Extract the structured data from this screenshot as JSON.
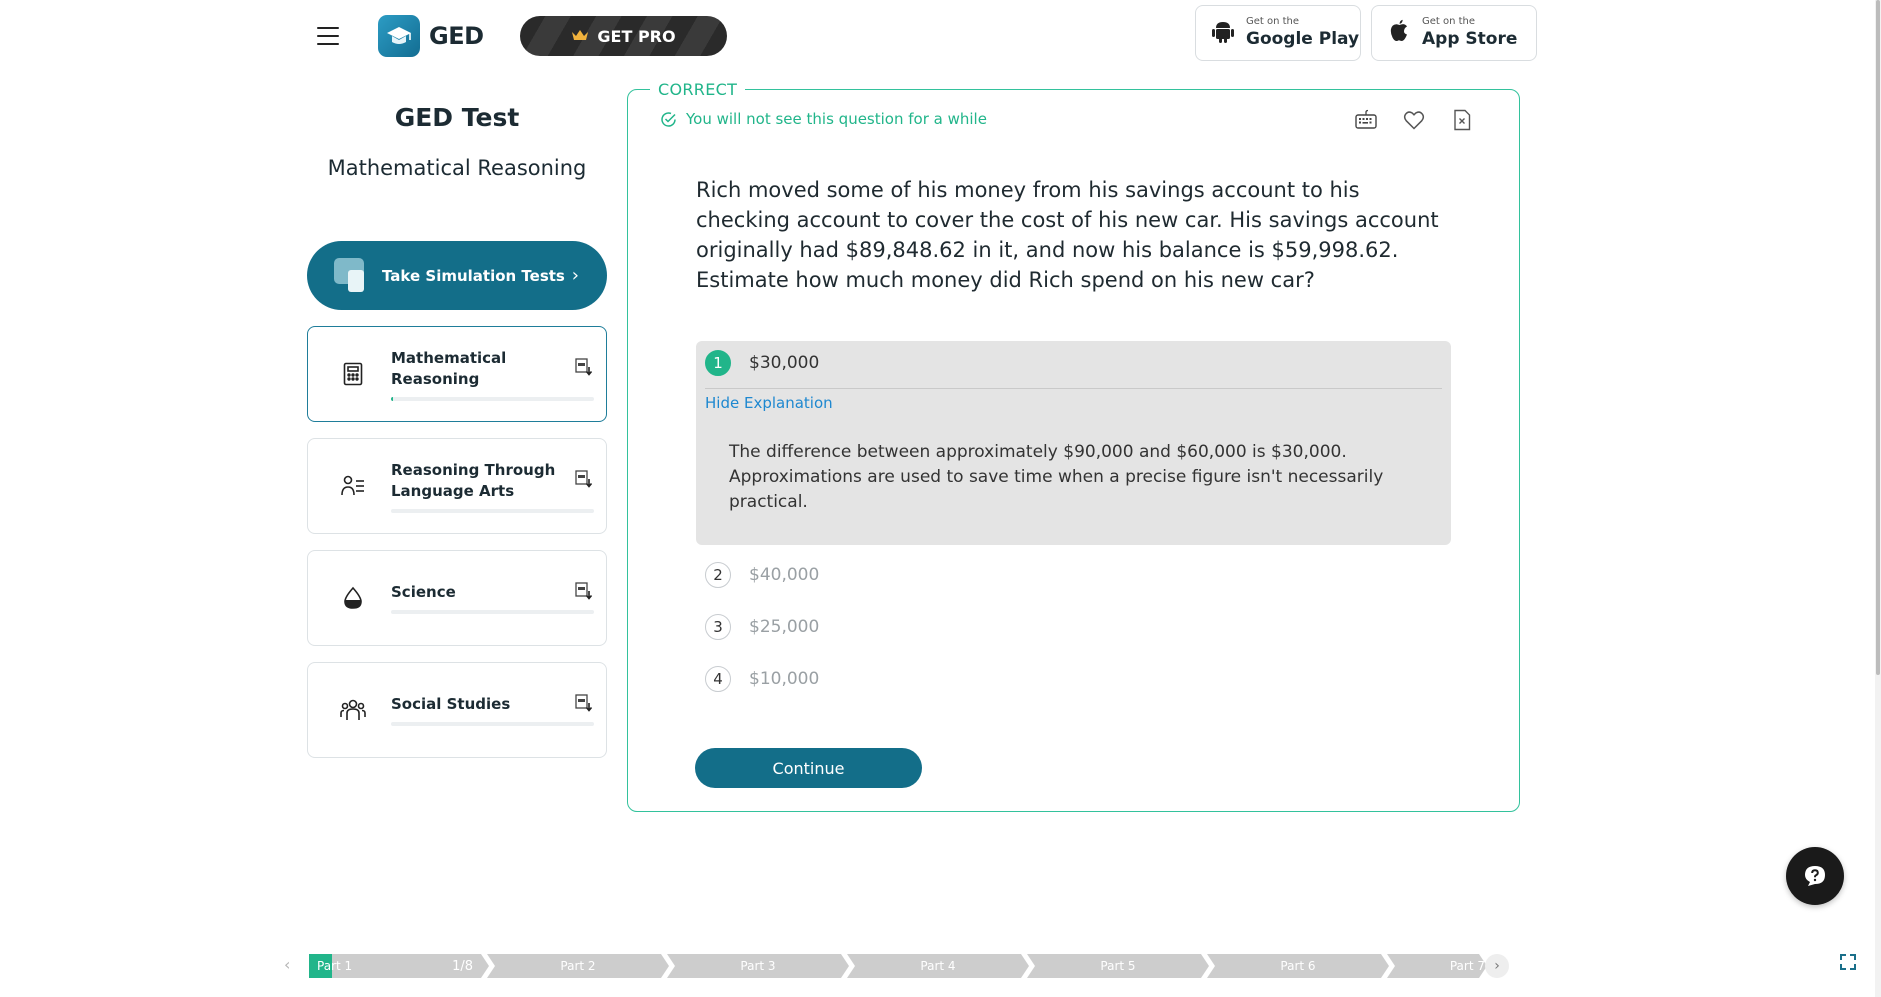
{
  "header": {
    "logo_text": "GED",
    "get_pro_label": "GET PRO",
    "google_play": {
      "small": "Get on the",
      "big": "Google Play"
    },
    "app_store": {
      "small": "Get on the",
      "big": "App Store"
    }
  },
  "sidebar": {
    "title": "GED Test",
    "subtitle": "Mathematical Reasoning",
    "simulation_label": "Take Simulation Tests",
    "subjects": [
      {
        "name": "Mathematical Reasoning",
        "progress": 0.01,
        "active": true
      },
      {
        "name": "Reasoning Through Language Arts",
        "progress": 0
      },
      {
        "name": "Science",
        "progress": 0
      },
      {
        "name": "Social Studies",
        "progress": 0
      }
    ]
  },
  "question": {
    "status_legend": "CORRECT",
    "status_message": "You will not see this question for a while",
    "text": "Rich moved some of his money from his savings account to his checking account to cover the cost of his new car. His savings account originally had $89,848.62 in it, and now his balance is $59,998.62. Estimate how much money did Rich spend on his new car?",
    "answers": [
      {
        "num": "1",
        "text": "$30,000",
        "correct": true
      },
      {
        "num": "2",
        "text": "$40,000"
      },
      {
        "num": "3",
        "text": "$25,000"
      },
      {
        "num": "4",
        "text": "$10,000"
      }
    ],
    "hide_explanation_label": "Hide Explanation",
    "explanation": "The difference between approximately $90,000 and $60,000 is $30,000. Approximations are used to save time when a precise figure isn't necessarily practical.",
    "continue_label": "Continue"
  },
  "parts_bar": {
    "current_progress": "1/8",
    "current_fraction": 0.125,
    "parts": [
      "Part 1",
      "Part 2",
      "Part 3",
      "Part 4",
      "Part 5",
      "Part 6",
      "Part 7"
    ]
  },
  "colors": {
    "accent": "#136e89",
    "correct": "#21b58a",
    "link": "#1e88d0"
  }
}
